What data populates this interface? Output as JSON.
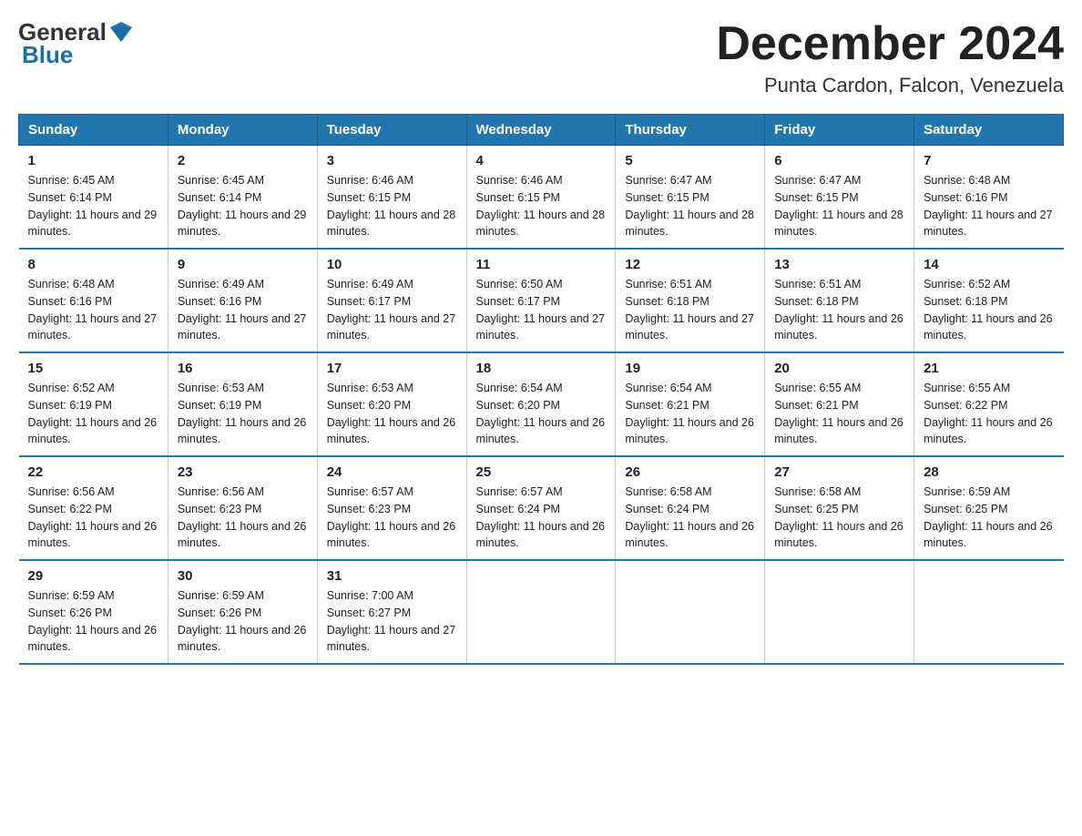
{
  "logo": {
    "text_general": "General",
    "text_blue": "Blue"
  },
  "title": "December 2024",
  "subtitle": "Punta Cardon, Falcon, Venezuela",
  "days_header": [
    "Sunday",
    "Monday",
    "Tuesday",
    "Wednesday",
    "Thursday",
    "Friday",
    "Saturday"
  ],
  "weeks": [
    [
      {
        "day": "1",
        "sunrise": "6:45 AM",
        "sunset": "6:14 PM",
        "daylight": "11 hours and 29 minutes."
      },
      {
        "day": "2",
        "sunrise": "6:45 AM",
        "sunset": "6:14 PM",
        "daylight": "11 hours and 29 minutes."
      },
      {
        "day": "3",
        "sunrise": "6:46 AM",
        "sunset": "6:15 PM",
        "daylight": "11 hours and 28 minutes."
      },
      {
        "day": "4",
        "sunrise": "6:46 AM",
        "sunset": "6:15 PM",
        "daylight": "11 hours and 28 minutes."
      },
      {
        "day": "5",
        "sunrise": "6:47 AM",
        "sunset": "6:15 PM",
        "daylight": "11 hours and 28 minutes."
      },
      {
        "day": "6",
        "sunrise": "6:47 AM",
        "sunset": "6:15 PM",
        "daylight": "11 hours and 28 minutes."
      },
      {
        "day": "7",
        "sunrise": "6:48 AM",
        "sunset": "6:16 PM",
        "daylight": "11 hours and 27 minutes."
      }
    ],
    [
      {
        "day": "8",
        "sunrise": "6:48 AM",
        "sunset": "6:16 PM",
        "daylight": "11 hours and 27 minutes."
      },
      {
        "day": "9",
        "sunrise": "6:49 AM",
        "sunset": "6:16 PM",
        "daylight": "11 hours and 27 minutes."
      },
      {
        "day": "10",
        "sunrise": "6:49 AM",
        "sunset": "6:17 PM",
        "daylight": "11 hours and 27 minutes."
      },
      {
        "day": "11",
        "sunrise": "6:50 AM",
        "sunset": "6:17 PM",
        "daylight": "11 hours and 27 minutes."
      },
      {
        "day": "12",
        "sunrise": "6:51 AM",
        "sunset": "6:18 PM",
        "daylight": "11 hours and 27 minutes."
      },
      {
        "day": "13",
        "sunrise": "6:51 AM",
        "sunset": "6:18 PM",
        "daylight": "11 hours and 26 minutes."
      },
      {
        "day": "14",
        "sunrise": "6:52 AM",
        "sunset": "6:18 PM",
        "daylight": "11 hours and 26 minutes."
      }
    ],
    [
      {
        "day": "15",
        "sunrise": "6:52 AM",
        "sunset": "6:19 PM",
        "daylight": "11 hours and 26 minutes."
      },
      {
        "day": "16",
        "sunrise": "6:53 AM",
        "sunset": "6:19 PM",
        "daylight": "11 hours and 26 minutes."
      },
      {
        "day": "17",
        "sunrise": "6:53 AM",
        "sunset": "6:20 PM",
        "daylight": "11 hours and 26 minutes."
      },
      {
        "day": "18",
        "sunrise": "6:54 AM",
        "sunset": "6:20 PM",
        "daylight": "11 hours and 26 minutes."
      },
      {
        "day": "19",
        "sunrise": "6:54 AM",
        "sunset": "6:21 PM",
        "daylight": "11 hours and 26 minutes."
      },
      {
        "day": "20",
        "sunrise": "6:55 AM",
        "sunset": "6:21 PM",
        "daylight": "11 hours and 26 minutes."
      },
      {
        "day": "21",
        "sunrise": "6:55 AM",
        "sunset": "6:22 PM",
        "daylight": "11 hours and 26 minutes."
      }
    ],
    [
      {
        "day": "22",
        "sunrise": "6:56 AM",
        "sunset": "6:22 PM",
        "daylight": "11 hours and 26 minutes."
      },
      {
        "day": "23",
        "sunrise": "6:56 AM",
        "sunset": "6:23 PM",
        "daylight": "11 hours and 26 minutes."
      },
      {
        "day": "24",
        "sunrise": "6:57 AM",
        "sunset": "6:23 PM",
        "daylight": "11 hours and 26 minutes."
      },
      {
        "day": "25",
        "sunrise": "6:57 AM",
        "sunset": "6:24 PM",
        "daylight": "11 hours and 26 minutes."
      },
      {
        "day": "26",
        "sunrise": "6:58 AM",
        "sunset": "6:24 PM",
        "daylight": "11 hours and 26 minutes."
      },
      {
        "day": "27",
        "sunrise": "6:58 AM",
        "sunset": "6:25 PM",
        "daylight": "11 hours and 26 minutes."
      },
      {
        "day": "28",
        "sunrise": "6:59 AM",
        "sunset": "6:25 PM",
        "daylight": "11 hours and 26 minutes."
      }
    ],
    [
      {
        "day": "29",
        "sunrise": "6:59 AM",
        "sunset": "6:26 PM",
        "daylight": "11 hours and 26 minutes."
      },
      {
        "day": "30",
        "sunrise": "6:59 AM",
        "sunset": "6:26 PM",
        "daylight": "11 hours and 26 minutes."
      },
      {
        "day": "31",
        "sunrise": "7:00 AM",
        "sunset": "6:27 PM",
        "daylight": "11 hours and 27 minutes."
      },
      null,
      null,
      null,
      null
    ]
  ]
}
